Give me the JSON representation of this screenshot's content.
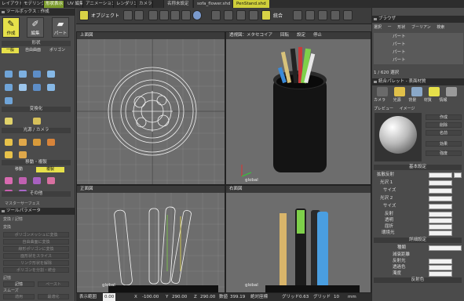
{
  "modes": [
    "レイアウト",
    "モデリング",
    "形状表示",
    "UV 編集",
    "アニメーション",
    "レンダリング",
    "カメラ"
  ],
  "active_mode_index": 2,
  "documents": [
    "名称未設定",
    "sofa_flower.shd",
    "PenStand.shd"
  ],
  "active_document_index": 2,
  "left_panel": {
    "title": "ツールボックス : 作成",
    "tabs": [
      "作成",
      "編集",
      "パート"
    ],
    "section_basic": "形状",
    "basic_tabs": [
      "一般",
      "自由曲面",
      "ポリゴン"
    ],
    "section_transform": "変換化",
    "section_light": "光源 / カメラ",
    "section_move": "移動・複製",
    "move_tabs": [
      "移動",
      "複製"
    ],
    "section_other": "その他",
    "master_surface": "マスターサーフェス",
    "tool_params": "ツールパラメータ",
    "params_sub": "変換 / 記憶",
    "params_group": "変換",
    "params_buttons": [
      "ポリゴンメッシュに変換",
      "自由曲面に変換",
      "線形ポリゴンに変換",
      "面形状をスライス",
      "リンク形状を解除",
      "ポリゴンを分割・統合"
    ],
    "memory_label": "記憶",
    "memory_buttons": [
      "記憶",
      "ペースト"
    ],
    "smooth_label": "スムーズ",
    "smooth_buttons": [
      "適用",
      "最適化"
    ]
  },
  "toolbar": {
    "object_label": "オブジェクト",
    "integrate_label": "統合"
  },
  "viewports": [
    {
      "name": "top",
      "labels": [
        "上面図",
        "",
        "",
        "",
        ""
      ]
    },
    {
      "name": "perspective",
      "labels": [
        "透視図：メタセコイア",
        "回転",
        "設定",
        "停止"
      ],
      "global": "global"
    },
    {
      "name": "front",
      "labels": [
        "正面図"
      ],
      "global": "global"
    },
    {
      "name": "right",
      "labels": [
        "右面図"
      ],
      "global": "global"
    }
  ],
  "right_panel": {
    "browser_title": "ブラウザ",
    "browser_tabs": [
      "選択",
      "ー",
      "形状",
      "ブーリアン",
      "検索"
    ],
    "browser_items": [
      "パート",
      "パート",
      "パート",
      "パート"
    ],
    "browser_count": "1 / 620 選択",
    "props_title": "統合パレット - 表面材質",
    "props_tabs": [
      "カメラ",
      "光源",
      "背景",
      "材質",
      "情報"
    ],
    "preview_tabs": [
      "プレビュー",
      "イメージ"
    ],
    "side_buttons": [
      "作成",
      "削除",
      "名前",
      "効果",
      "強度"
    ],
    "basic_section": "基本設定",
    "fields": [
      "拡散反射",
      "光沢 1",
      "サイズ",
      "光沢 2",
      "サイズ",
      "反射",
      "透明",
      "屈折",
      "環境光"
    ],
    "detail_section": "詳細設定",
    "type_label": "種類",
    "attenuation": "減衰距離",
    "attenuation_fields": [
      "反射光",
      "透過色",
      "濁度"
    ],
    "reflect_section": "反射色"
  },
  "status": {
    "label": "表示範囲",
    "zoom": "0.00",
    "x_label": "X",
    "x": "-100.00",
    "y_label": "Y",
    "y": "290.00",
    "z_label": "Z",
    "z": "290.00",
    "count_label": "数値",
    "count": "399.19",
    "coord_label": "絶対座標",
    "grid_label": "グリッド",
    "grid": "0.63",
    "grid2_label": "グリッド",
    "grid2": "10",
    "unit": "mm"
  },
  "colors": {
    "accent": "#e6e04a",
    "mode_active": "#7a9a2a",
    "doc_active": "#cfcf3a"
  }
}
